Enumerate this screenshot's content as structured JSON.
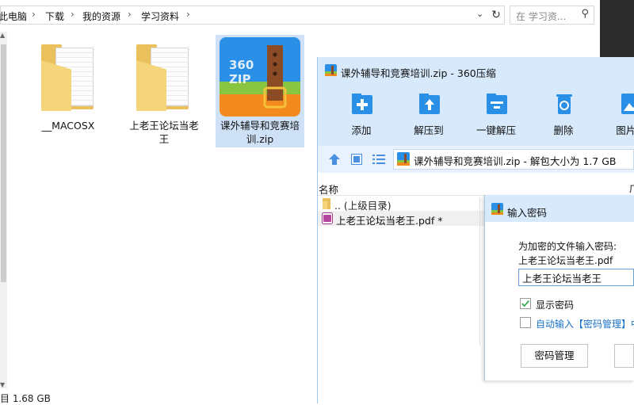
{
  "explorer": {
    "breadcrumbs": [
      "此电脑",
      "下载",
      "我的资源",
      "学习资料"
    ],
    "search_placeholder": "在 学习资...",
    "items": [
      {
        "name": "__MACOSX",
        "type": "folder"
      },
      {
        "name": "上老王论坛当老王",
        "type": "folder"
      },
      {
        "name": "课外辅导和竞赛培训.zip",
        "type": "zip",
        "selected": true
      }
    ],
    "zip_icon_text": "360\nZIP",
    "status_text": "目  1.68 GB"
  },
  "app360": {
    "title": "课外辅导和竞赛培训.zip - 360压缩",
    "toolbar": [
      "添加",
      "解压到",
      "一键解压",
      "删除",
      "图片户"
    ],
    "path": "课外辅导和竞赛培训.zip - 解包大小为 1.7 GB",
    "columns": {
      "name": "名称",
      "size_stub": "广"
    },
    "rows": [
      {
        "name": ".. (上级目录)"
      },
      {
        "name": "上老王论坛当老王.pdf *"
      }
    ]
  },
  "password_dialog": {
    "title": "输入密码",
    "prompt": "为加密的文件输入密码:",
    "file": "上老王论坛当老王.pdf",
    "input_value": "上老王论坛当老王",
    "show_password_label": "显示密码",
    "show_password_checked": true,
    "auto_input_label": "自动输入【密码管理】中",
    "auto_input_checked": false,
    "manage_button": "密码管理"
  },
  "colors": {
    "accent": "#2a8fe6",
    "selection": "#cfe1f6",
    "header": "#d7e9fb"
  }
}
